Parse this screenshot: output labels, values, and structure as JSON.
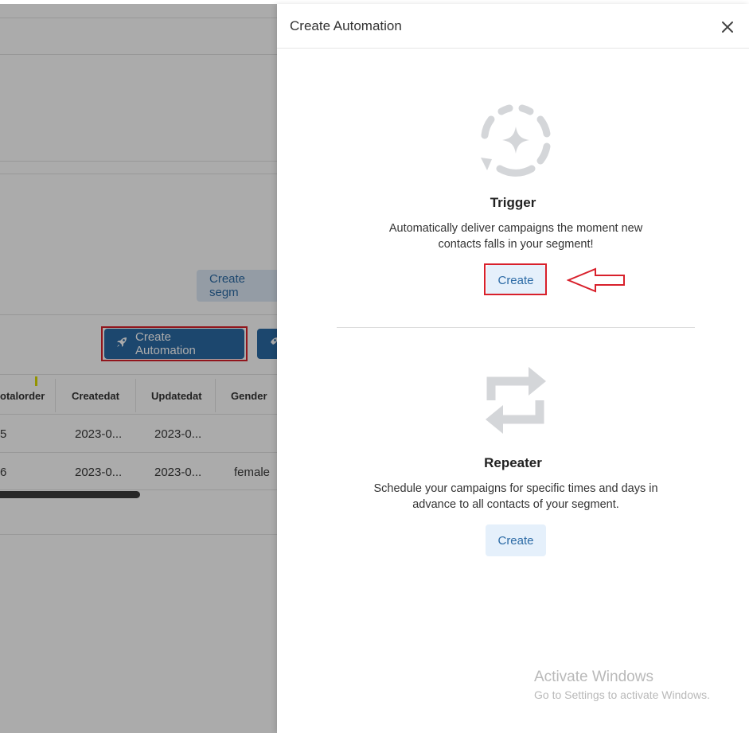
{
  "background": {
    "create_segment_label": "Create segm",
    "create_automation_label": "Create Automation",
    "table": {
      "headers": [
        "otalorder",
        "Createdat",
        "Updatedat",
        "Gender"
      ],
      "rows": [
        [
          "5",
          "2023-0...",
          "2023-0...",
          ""
        ],
        [
          "6",
          "2023-0...",
          "2023-0...",
          "female"
        ]
      ]
    }
  },
  "drawer": {
    "title": "Create Automation",
    "close_icon": "close-icon",
    "trigger": {
      "icon": "trigger-sparkle-cycle-icon",
      "title": "Trigger",
      "description_line1": "Automatically deliver campaigns the moment new",
      "description_line2": "contacts falls in your segment!",
      "button_label": "Create"
    },
    "repeater": {
      "icon": "repeat-arrows-icon",
      "title": "Repeater",
      "description_line1": "Schedule your campaigns for specific times and days in",
      "description_line2": "advance to all contacts of your segment.",
      "button_label": "Create"
    }
  },
  "annotations": {
    "highlight_color": "#d8202b",
    "arrow_icon": "left-arrow-outline-icon"
  },
  "watermark": {
    "line1": "Activate Windows",
    "line2": "Go to Settings to activate Windows."
  },
  "colors": {
    "primary": "#2b6aa5",
    "light_button": "#e5f0fb",
    "overlay": "rgba(0,0,0,0.33)"
  }
}
